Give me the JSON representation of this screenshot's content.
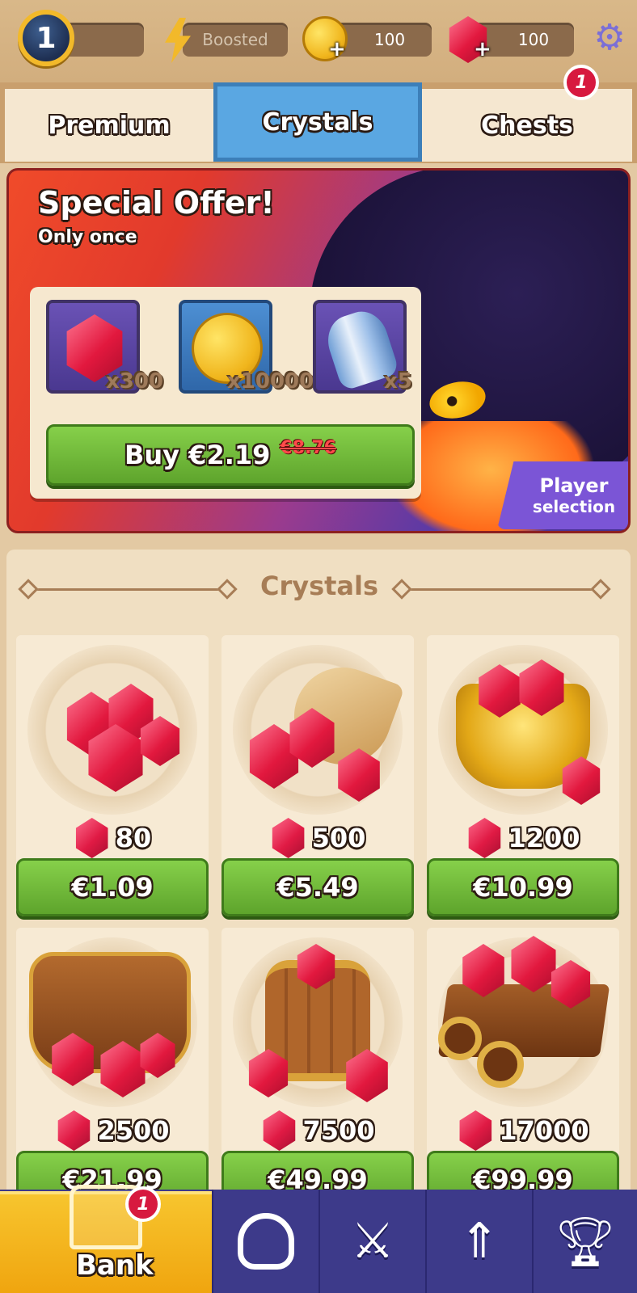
{
  "top_bar": {
    "level": "1",
    "boost_label": "Boosted",
    "coins": "100",
    "gems": "100",
    "settings_icon": "gear-icon"
  },
  "tabs": [
    {
      "label": "Premium",
      "active": false
    },
    {
      "label": "Crystals",
      "active": true
    },
    {
      "label": "Chests",
      "active": false,
      "badge": "1"
    }
  ],
  "offer": {
    "title": "Special Offer!",
    "subtitle": "Only once",
    "items": [
      {
        "icon": "crystal-icon",
        "qty": "x300"
      },
      {
        "icon": "coin-icon",
        "qty": "x10000"
      },
      {
        "icon": "scroll-icon",
        "qty": "x5"
      }
    ],
    "buy_label": "Buy €2.19",
    "old_price": "€8.76",
    "player_selection": {
      "line1": "Player",
      "line2": "selection"
    }
  },
  "shop": {
    "title": "Crystals",
    "packs": [
      {
        "art": "crystal-pile",
        "amount": "80",
        "price": "€1.09"
      },
      {
        "art": "crystal-horn",
        "amount": "500",
        "price": "€5.49"
      },
      {
        "art": "crystal-pot",
        "amount": "1200",
        "price": "€10.99"
      },
      {
        "art": "crystal-bag",
        "amount": "2500",
        "price": "€21.99"
      },
      {
        "art": "crystal-barrel",
        "amount": "7500",
        "price": "€49.99"
      },
      {
        "art": "crystal-cart",
        "amount": "17000",
        "price": "€99.99"
      }
    ]
  },
  "bottom_nav": {
    "bank_label": "Bank",
    "bank_badge": "1",
    "items": [
      "hood-icon",
      "crossed-swords-icon",
      "upgrade-arrows-icon",
      "trophy-icon"
    ]
  },
  "colors": {
    "accent_green": "#6bb434",
    "tab_active_blue": "#5aa7e2",
    "nav_purple": "#3d3a8a",
    "bank_gold": "#f4b51e",
    "badge_red": "#d7193f"
  }
}
